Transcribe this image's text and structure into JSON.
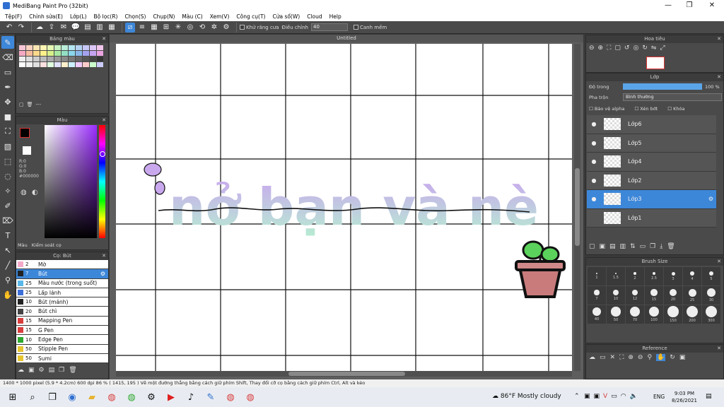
{
  "window": {
    "title": "MediBang Paint Pro (32bit)",
    "controls": {
      "minimize": "—",
      "maximize": "❐",
      "close": "✕"
    }
  },
  "menu": [
    "Tệp(F)",
    "Chỉnh sửa(E)",
    "Lớp(L)",
    "Bộ lọc(R)",
    "Chọn(S)",
    "Chụp(N)",
    "Màu (C)",
    "Xem(V)",
    "Công cụ(T)",
    "Cửa sổ(W)",
    "Cloud",
    "Help"
  ],
  "toolbar": {
    "antialias_label": "Khử răng cưa",
    "correction_label": "Điều chỉnh",
    "correction_value": "40",
    "smooth_label": "Canh mềm"
  },
  "panels": {
    "palette_title": "Bảng màu",
    "palette_footer": "---",
    "color_title": "Màu",
    "color_readout": {
      "r": "R:0",
      "g": "G:0",
      "b": "B:0",
      "hex": "#000000"
    },
    "color_tabs": [
      "Màu",
      "Kiểm soát cọ"
    ],
    "brush_title": "Cọ: Bút",
    "navigator_title": "Hoa tiêu",
    "layer_title": "Lớp",
    "brushsize_title": "Brush Size",
    "reference_title": "Reference"
  },
  "palette_colors": [
    "#f7c6d6",
    "#f9d2bf",
    "#fbe6b3",
    "#fff5b3",
    "#e6f7b3",
    "#c8f2c2",
    "#b9ecd9",
    "#b3e6f2",
    "#b3d1f2",
    "#c6c6f7",
    "#dcc6f7",
    "#f2c6ec",
    "#f4a9c1",
    "#f6bb9e",
    "#fbd98a",
    "#fff08a",
    "#d8f08a",
    "#a9e8a3",
    "#92dfc3",
    "#8ad6ea",
    "#8ab8ea",
    "#a3a3f0",
    "#c5a3f0",
    "#eaa3e0",
    "#eeeeee",
    "#dddddd",
    "#cccccc",
    "#bbbbbb",
    "#aaaaaa",
    "#999999",
    "#888888",
    "#777777",
    "#666666",
    "#555555",
    "#444444",
    "#333333",
    "#ffffff",
    "#f0f0f0",
    "#e0e0e0",
    "#ffe0e0",
    "#e0ffe0",
    "#e0e0ff",
    "#fff0cc",
    "#ccf0ff",
    "#f0ccff",
    "#ffcccc",
    "#ccffcc",
    "#ccccff"
  ],
  "brushes": [
    {
      "size": "2",
      "name": "Mờ",
      "color": "#f4a9c9"
    },
    {
      "size": "7",
      "name": "Bút",
      "color": "#222222",
      "selected": true
    },
    {
      "size": "25",
      "name": "Màu nước (trong suốt)",
      "color": "#5ab7e8"
    },
    {
      "size": "25",
      "name": "Lấp lánh",
      "color": "#3d6fd9"
    },
    {
      "size": "10",
      "name": "Bút (mảnh)",
      "color": "#222222"
    },
    {
      "size": "20",
      "name": "Bút chì",
      "color": "#444444"
    },
    {
      "size": "15",
      "name": "Mapping Pen",
      "color": "#d93d3d"
    },
    {
      "size": "15",
      "name": "G Pen",
      "color": "#d93d3d"
    },
    {
      "size": "10",
      "name": "Edge Pen",
      "color": "#2fa82f"
    },
    {
      "size": "50",
      "name": "Stipple Pen",
      "color": "#e6c52f"
    },
    {
      "size": "50",
      "name": "Sumi",
      "color": "#e6c52f"
    }
  ],
  "document": {
    "tab_title": "Untitled"
  },
  "canvas": {
    "lettering": "nở bạn và nè"
  },
  "layers": {
    "opacity_label": "Độ trong",
    "opacity_value": "100 %",
    "blend_label": "Pha trộn",
    "blend_value": "Bình thường",
    "protect_alpha": "Bảo vệ alpha",
    "clipping": "Xén bớt",
    "lock": "Khóa",
    "items": [
      {
        "name": "Lớp6"
      },
      {
        "name": "Lớp5"
      },
      {
        "name": "Lớp4"
      },
      {
        "name": "Lớp2"
      },
      {
        "name": "Lớp3",
        "selected": true
      },
      {
        "name": "Lớp1"
      }
    ]
  },
  "brush_sizes": [
    "1",
    "1.5",
    "2",
    "2.5",
    "3",
    "4",
    "5",
    "7",
    "10",
    "12",
    "15",
    "20",
    "25",
    "30",
    "40",
    "50",
    "70",
    "100",
    "150",
    "200",
    "300"
  ],
  "status": {
    "text": "1400 * 1000 pixel  (5.9 * 4.2cm)  600 dpi  86 %  ( 1415, 195 )  Vẽ một đường thẳng bằng cách giữ phím Shift, Thay đổi cỡ cọ bằng cách giữ phím Ctrl, Alt và kéo"
  },
  "taskbar": {
    "weather": "86°F  Mostly cloudy",
    "lang": "ENG",
    "time": "9:03 PM",
    "date": "8/26/2021"
  }
}
